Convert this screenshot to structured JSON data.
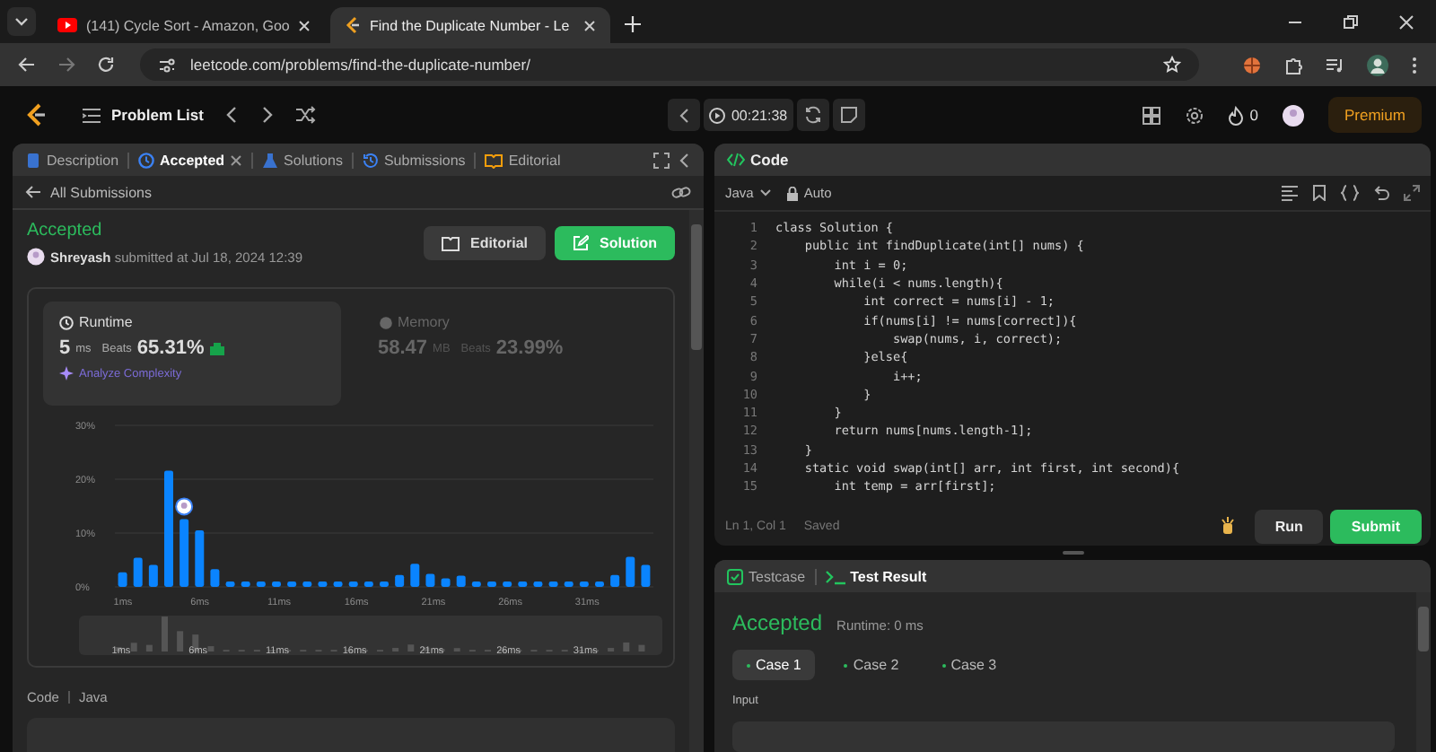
{
  "browser": {
    "tabs": [
      {
        "title": "(141) Cycle Sort - Amazon, Goo",
        "kind": "video",
        "selected": false
      },
      {
        "title": "Find the Duplicate Number - Le",
        "kind": "leetcode",
        "selected": true
      }
    ],
    "url": "leetcode.com/problems/find-the-duplicate-number/"
  },
  "navbar": {
    "problem_list": "Problem List",
    "timer": "00:21:38",
    "streak": "0",
    "premium": "Premium"
  },
  "left_panel": {
    "tabs": [
      {
        "label": "Description",
        "kind": "description",
        "selected": false,
        "closable": false
      },
      {
        "label": "Accepted",
        "kind": "accepted",
        "selected": true,
        "closable": true
      },
      {
        "label": "Solutions",
        "kind": "solutions",
        "selected": false,
        "closable": false
      },
      {
        "label": "Submissions",
        "kind": "submissions",
        "selected": false,
        "closable": false
      },
      {
        "label": "Editorial",
        "kind": "editorial",
        "selected": false,
        "closable": false
      }
    ],
    "back_link": "All Submissions",
    "status": "Accepted",
    "user": "Shreyash",
    "submitted": "submitted at Jul 18, 2024 12:39",
    "editorial_button": "Editorial",
    "solution_button": "Solution",
    "runtime": {
      "title": "Runtime",
      "value": "5",
      "unit": "ms",
      "beats_label": "Beats",
      "beats": "65.31%",
      "selected": true
    },
    "analyze": "Analyze Complexity",
    "memory": {
      "title": "Memory",
      "value": "58.47",
      "unit": "MB",
      "beats_label": "Beats",
      "beats": "23.99%",
      "selected": false
    },
    "chart_data": {
      "type": "bar",
      "x": [
        1,
        2,
        3,
        4,
        5,
        6,
        7,
        8,
        9,
        10,
        11,
        12,
        13,
        14,
        15,
        16,
        17,
        18,
        19,
        20,
        21,
        22,
        23,
        24,
        25,
        26,
        27,
        28,
        29,
        30,
        31,
        32,
        33,
        34,
        35
      ],
      "values": [
        2.7,
        5.4,
        4.1,
        21.6,
        12.6,
        10.5,
        3.3,
        1,
        1,
        1,
        1,
        1,
        1,
        1,
        1,
        1,
        1,
        1,
        2.2,
        4.3,
        2.4,
        1.6,
        2.1,
        1,
        1,
        1,
        1,
        1,
        1,
        1,
        1,
        1,
        2.2,
        5.6,
        4.1
      ],
      "xlim": [
        0.5,
        35.5
      ],
      "ylim": [
        0,
        30
      ],
      "yticks": [
        {
          "value": 0,
          "label": "0%"
        },
        {
          "value": 10,
          "label": "10%"
        },
        {
          "value": 20,
          "label": "20%"
        },
        {
          "value": 30,
          "label": "30%"
        }
      ],
      "xticks": [
        {
          "value": 1,
          "label": "1ms"
        },
        {
          "value": 6,
          "label": "6ms"
        },
        {
          "value": 11,
          "label": "11ms"
        },
        {
          "value": 16,
          "label": "16ms"
        },
        {
          "value": 21,
          "label": "21ms"
        },
        {
          "value": 26,
          "label": "26ms"
        },
        {
          "value": 31,
          "label": "31ms"
        }
      ]
    },
    "navigator_labels": [
      "1ms",
      "6ms",
      "11ms",
      "16ms",
      "21ms",
      "26ms",
      "31ms"
    ],
    "code_label": "Code",
    "code_language": "Java"
  },
  "editor": {
    "title": "Code",
    "language": "Java",
    "mode": "Auto",
    "lines": [
      {
        "n": "1",
        "code": "class Solution {"
      },
      {
        "n": "2",
        "code": "    public int findDuplicate(int[] nums) {"
      },
      {
        "n": "3",
        "code": "        int i = 0;"
      },
      {
        "n": "4",
        "code": "        while(i < nums.length){"
      },
      {
        "n": "5",
        "code": "            int correct = nums[i] - 1;"
      },
      {
        "n": "6",
        "code": "            if(nums[i] != nums[correct]){"
      },
      {
        "n": "7",
        "code": "                swap(nums, i, correct);"
      },
      {
        "n": "8",
        "code": "            }else{"
      },
      {
        "n": "9",
        "code": "                i++;"
      },
      {
        "n": "10",
        "code": "            }"
      },
      {
        "n": "11",
        "code": "        }"
      },
      {
        "n": "12",
        "code": "        return nums[nums.length-1];"
      },
      {
        "n": "13",
        "code": "    }"
      },
      {
        "n": "14",
        "code": "    static void swap(int[] arr, int first, int second){"
      },
      {
        "n": "15",
        "code": "        int temp = arr[first];"
      }
    ],
    "status": "Ln 1, Col 1",
    "saved": "Saved",
    "run": "Run",
    "submit": "Submit"
  },
  "results": {
    "tabs": [
      {
        "label": "Testcase",
        "kind": "testcase",
        "selected": false
      },
      {
        "label": "Test Result",
        "kind": "result",
        "selected": true
      }
    ],
    "status": "Accepted",
    "runtime": "Runtime: 0 ms",
    "cases": [
      {
        "label": "Case 1",
        "selected": true
      },
      {
        "label": "Case 2",
        "selected": false
      },
      {
        "label": "Case 3",
        "selected": false
      }
    ],
    "input_label": "Input"
  }
}
